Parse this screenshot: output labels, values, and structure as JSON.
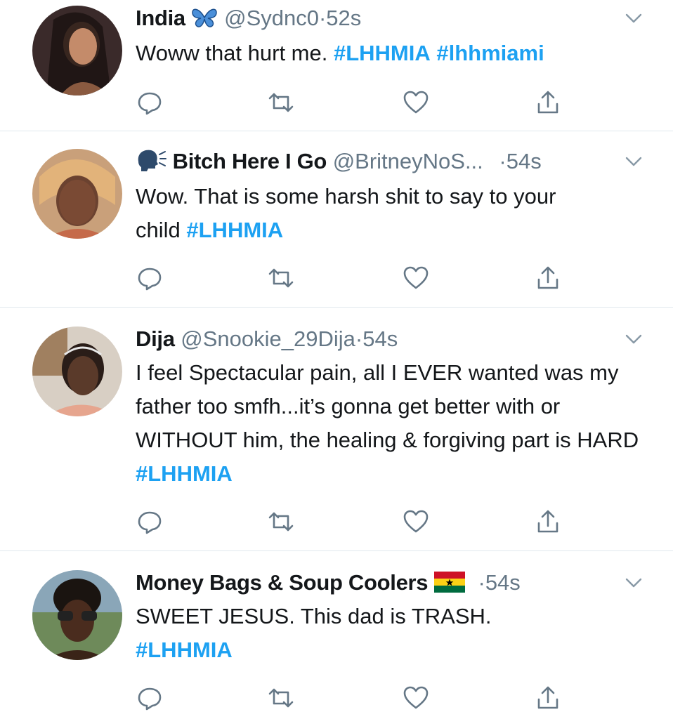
{
  "colors": {
    "accent": "#1da1f2",
    "secondary": "#657786",
    "text": "#14171a",
    "divider": "#e1e8ed"
  },
  "icons": {
    "reply": "reply-icon",
    "retweet": "retweet-icon",
    "like": "heart-icon",
    "share": "share-icon",
    "more": "chevron-down-icon"
  },
  "tweets": [
    {
      "name": "India",
      "name_emoji": "butterfly-emoji",
      "handle": "@Sydnc0",
      "dot": "·",
      "time": "52s",
      "text": "Woww that hurt me. ",
      "hashtags": [
        "#LHHMIA",
        "#lhhmiami"
      ]
    },
    {
      "name_emoji": "speaking-head-emoji",
      "name": "Bitch Here I Go",
      "handle": "@BritneyNoS...",
      "dot": "·",
      "time": "54s",
      "text": "Wow. That is some harsh shit to say to your child ",
      "hashtags": [
        "#LHHMIA"
      ]
    },
    {
      "name": "Dija",
      "handle": "@Snookie_29Dija",
      "dot": "·",
      "time": "54s",
      "text": "I feel Spectacular pain, all I EVER wanted was my father too smfh...it’s gonna get better with or WITHOUT him, the healing & forgiving part is HARD ",
      "hashtags": [
        "#LHHMIA"
      ]
    },
    {
      "name": "Money Bags & Soup Coolers",
      "name_emoji": "ghana-flag-emoji",
      "dot": "·",
      "time": "54s",
      "text": "SWEET JESUS. This dad is TRASH.",
      "hashtags": [
        "#LHHMIA"
      ]
    }
  ]
}
